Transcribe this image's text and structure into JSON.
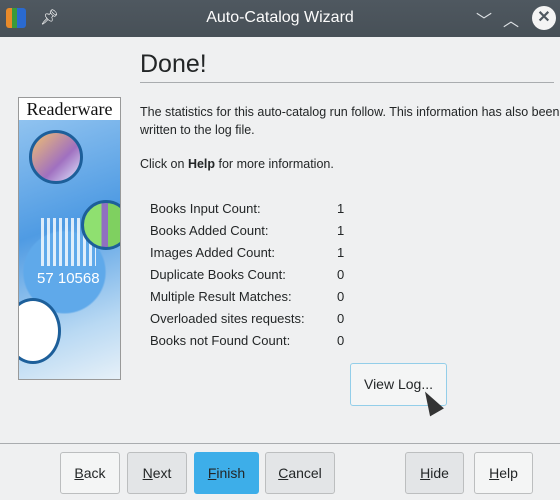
{
  "window": {
    "title": "Auto-Catalog Wizard"
  },
  "heading": "Done!",
  "sidebar": {
    "brand": "Readerware",
    "barcode_number": "57 10568"
  },
  "intro": "The statistics for this auto-catalog run follow. This information has also been written to the log file.",
  "help_text": {
    "prefix": "Click on ",
    "bold": "Help",
    "suffix": " for more information."
  },
  "stats": [
    {
      "label": "Books Input Count:",
      "value": "1"
    },
    {
      "label": "Books Added Count:",
      "value": "1"
    },
    {
      "label": "Images Added Count:",
      "value": "1"
    },
    {
      "label": "Duplicate Books Count:",
      "value": "0"
    },
    {
      "label": "Multiple Result Matches:",
      "value": "0"
    },
    {
      "label": "Overloaded sites requests:",
      "value": "0"
    },
    {
      "label": "Books not Found Count:",
      "value": "0"
    }
  ],
  "view_log": "View Log...",
  "buttons": {
    "back": {
      "m": "B",
      "rest": "ack"
    },
    "next": {
      "m": "N",
      "rest": "ext"
    },
    "finish": {
      "m": "F",
      "rest": "inish"
    },
    "cancel": {
      "m": "C",
      "rest": "ancel"
    },
    "hide": {
      "m": "H",
      "rest": "ide"
    },
    "help": {
      "m": "H",
      "rest": "elp"
    }
  },
  "colors": {
    "accent": "#3daee9",
    "titlebar": "#4f5860"
  }
}
